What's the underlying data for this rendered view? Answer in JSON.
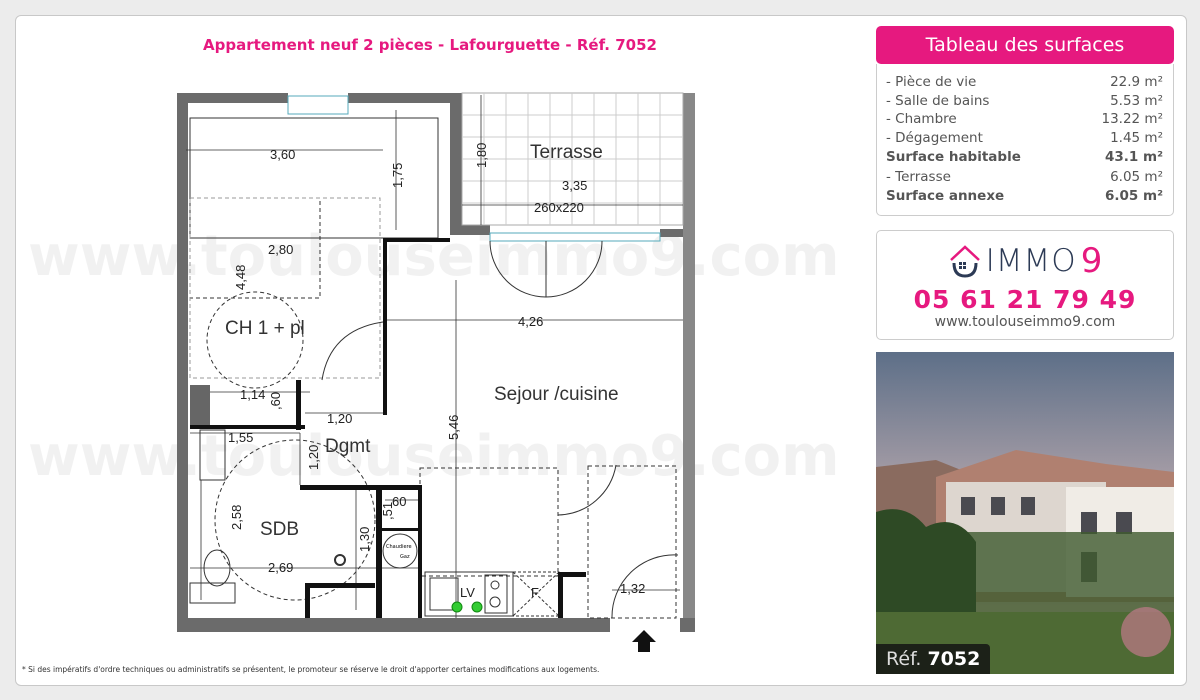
{
  "title": "Appartement neuf 2 pièces - Lafourguette - Réf. 7052",
  "footnote": "* Si des impératifs d'ordre techniques ou administratifs se présentent, le promoteur se réserve le droit d'apporter certaines modifications aux logements.",
  "watermark": "www.toulouseimmo9.com",
  "plan": {
    "rooms": {
      "terrasse": "Terrasse",
      "chambre": "CH 1 + pl",
      "sejour": "Sejour /cuisine",
      "dgmt": "Dgmt",
      "sdb": "SDB",
      "chaudiere1": "Chaudiere",
      "chaudiere2": "Gaz",
      "lv": "LV",
      "f": "F"
    },
    "dims": {
      "d360": "3,60",
      "d175": "1,75",
      "d180": "1,80",
      "d335": "3,35",
      "window": "260x220",
      "d280": "2,80",
      "d448": "4,48",
      "d426": "4,26",
      "d114": "1,14",
      "d60a": ",60",
      "d120a": "1,20",
      "d155": "1,55",
      "d120b": "1,20",
      "d546": "5,46",
      "d60b": "60",
      "d51": ",51",
      "d258": "2,58",
      "d130": "1,30",
      "d269": "2,69",
      "d132": "1,32"
    }
  },
  "surfaces": {
    "header": "Tableau des surfaces",
    "rows": [
      {
        "label": "- Pièce de vie",
        "value": "22.9 m²",
        "bold": false
      },
      {
        "label": "- Salle de bains",
        "value": "5.53 m²",
        "bold": false
      },
      {
        "label": "- Chambre",
        "value": "13.22 m²",
        "bold": false
      },
      {
        "label": "- Dégagement",
        "value": "1.45 m²",
        "bold": false
      },
      {
        "label": "Surface habitable",
        "value": "43.1 m²",
        "bold": true
      },
      {
        "label": "- Terrasse",
        "value": "6.05 m²",
        "bold": false
      },
      {
        "label": "Surface annexe",
        "value": "6.05 m²",
        "bold": true
      }
    ]
  },
  "agency": {
    "logo_text": "IMMO",
    "logo_nine": "9",
    "phone": "05 61 21 79 49",
    "website": "www.toulouseimmo9.com"
  },
  "photo": {
    "ref_label": "Réf.",
    "ref_number": "7052"
  },
  "colors": {
    "accent": "#e6197f",
    "wall": "#6b6b6b",
    "logo_dark": "#2c3a55"
  }
}
